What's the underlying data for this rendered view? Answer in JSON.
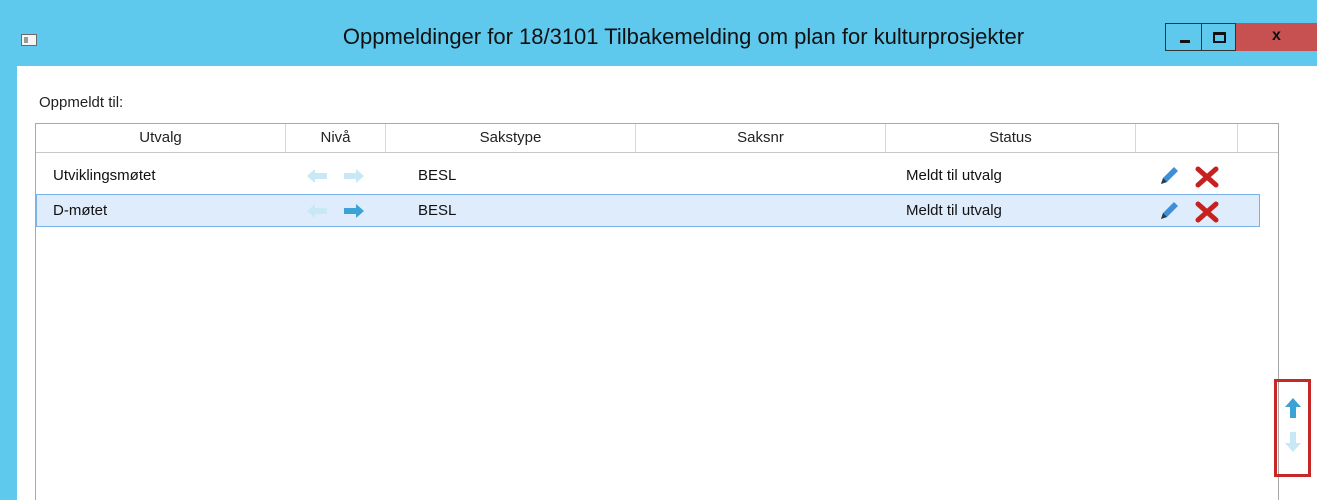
{
  "window": {
    "title": "Oppmeldinger for 18/3101 Tilbakemelding om plan for kulturprosjekter",
    "close_glyph": "x"
  },
  "section_label": "Oppmeldt til:",
  "columns": [
    "Utvalg",
    "Nivå",
    "Sakstype",
    "Saksnr",
    "Status"
  ],
  "rows": [
    {
      "utvalg": "Utviklingsmøtet",
      "sakstype": "BESL",
      "saksnr": "",
      "status": "Meldt til utvalg",
      "selected": false
    },
    {
      "utvalg": "D-møtet",
      "sakstype": "BESL",
      "saksnr": "",
      "status": "Meldt til utvalg",
      "selected": true
    }
  ],
  "icons": {
    "app": "window-icon",
    "level_up": "arrow-left-icon",
    "level_down": "arrow-right-icon",
    "edit": "pencil-icon",
    "delete": "red-x-icon",
    "move_up": "arrow-up-icon",
    "move_down": "arrow-down-icon"
  },
  "colors": {
    "titlebar": "#5ec8ed",
    "close": "#c75050",
    "selection": "#deecfb",
    "highlight_box": "#c62828"
  }
}
